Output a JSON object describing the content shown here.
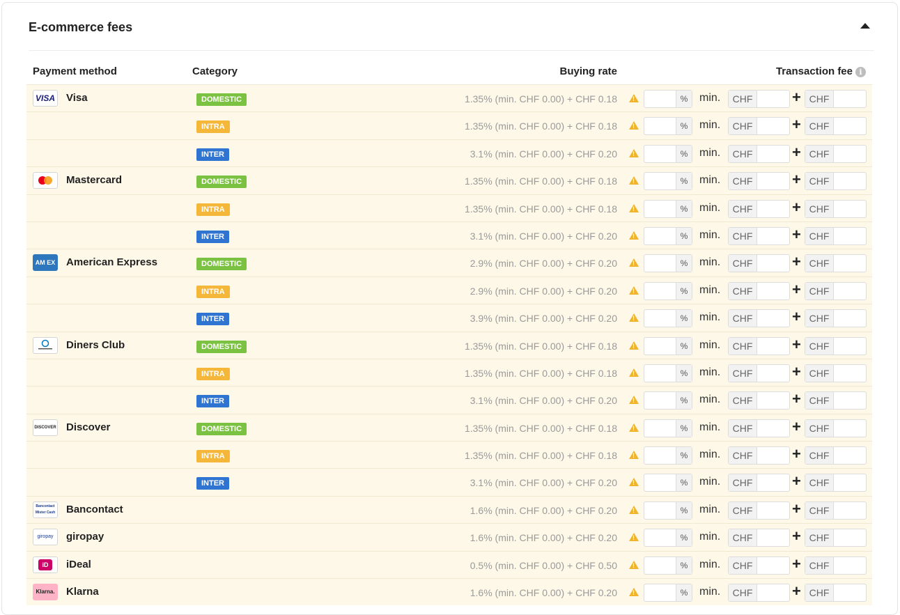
{
  "card": {
    "title": "E-commerce fees"
  },
  "columns": {
    "payment_method": "Payment method",
    "category": "Category",
    "buying_rate": "Buying rate",
    "transaction_fee": "Transaction fee"
  },
  "labels": {
    "percent": "%",
    "min": "min.",
    "currency": "CHF",
    "plus": "+"
  },
  "colors": {
    "domestic": "#7cc242",
    "intra": "#f4b73a",
    "inter": "#2f74d0",
    "warning": "#f1b32a",
    "row_bg": "#fdf8e7"
  },
  "rows": [
    {
      "method": "Visa",
      "logo_text": "VISA",
      "logo": "visa-logo",
      "category": "DOMESTIC",
      "rate": "1.35% (min. CHF 0.00) + CHF 0.18"
    },
    {
      "method": "",
      "logo": "",
      "category": "INTRA",
      "rate": "1.35% (min. CHF 0.00) + CHF 0.18"
    },
    {
      "method": "",
      "logo": "",
      "category": "INTER",
      "rate": "3.1% (min. CHF 0.00) + CHF 0.20"
    },
    {
      "method": "Mastercard",
      "logo_text": "",
      "logo": "mastercard-logo",
      "category": "DOMESTIC",
      "rate": "1.35% (min. CHF 0.00) + CHF 0.18"
    },
    {
      "method": "",
      "logo": "",
      "category": "INTRA",
      "rate": "1.35% (min. CHF 0.00) + CHF 0.18"
    },
    {
      "method": "",
      "logo": "",
      "category": "INTER",
      "rate": "3.1% (min. CHF 0.00) + CHF 0.20"
    },
    {
      "method": "American Express",
      "logo_text": "AM EX",
      "logo": "amex-logo",
      "category": "DOMESTIC",
      "rate": "2.9% (min. CHF 0.00) + CHF 0.20"
    },
    {
      "method": "",
      "logo": "",
      "category": "INTRA",
      "rate": "2.9% (min. CHF 0.00) + CHF 0.20"
    },
    {
      "method": "",
      "logo": "",
      "category": "INTER",
      "rate": "3.9% (min. CHF 0.00) + CHF 0.20"
    },
    {
      "method": "Diners Club",
      "logo_text": "",
      "logo": "diners-club-logo",
      "category": "DOMESTIC",
      "rate": "1.35% (min. CHF 0.00) + CHF 0.18"
    },
    {
      "method": "",
      "logo": "",
      "category": "INTRA",
      "rate": "1.35% (min. CHF 0.00) + CHF 0.18"
    },
    {
      "method": "",
      "logo": "",
      "category": "INTER",
      "rate": "3.1% (min. CHF 0.00) + CHF 0.20"
    },
    {
      "method": "Discover",
      "logo_text": "DISCOVER",
      "logo": "discover-logo",
      "category": "DOMESTIC",
      "rate": "1.35% (min. CHF 0.00) + CHF 0.18"
    },
    {
      "method": "",
      "logo": "",
      "category": "INTRA",
      "rate": "1.35% (min. CHF 0.00) + CHF 0.18"
    },
    {
      "method": "",
      "logo": "",
      "category": "INTER",
      "rate": "3.1% (min. CHF 0.00) + CHF 0.20"
    },
    {
      "method": "Bancontact",
      "logo_text": "Bancontact Mister Cash",
      "logo": "bancontact-logo",
      "category": "",
      "rate": "1.6% (min. CHF 0.00) + CHF 0.20"
    },
    {
      "method": "giropay",
      "logo_text": "giropay",
      "logo": "giropay-logo",
      "category": "",
      "rate": "1.6% (min. CHF 0.00) + CHF 0.20"
    },
    {
      "method": "iDeal",
      "logo_text": "iD",
      "logo": "ideal-logo",
      "category": "",
      "rate": "0.5% (min. CHF 0.00) + CHF 0.50"
    },
    {
      "method": "Klarna",
      "logo_text": "Klarna.",
      "logo": "klarna-logo",
      "category": "",
      "rate": "1.6% (min. CHF 0.00) + CHF 0.20"
    }
  ]
}
